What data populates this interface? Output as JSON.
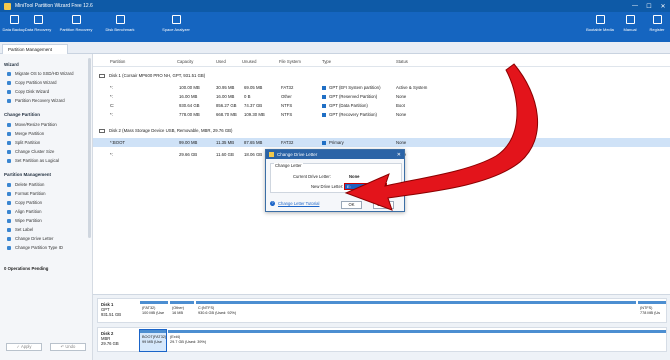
{
  "window": {
    "title": "MiniTool Partition Wizard Free 12.6",
    "controls": [
      "—",
      "☐",
      "✕"
    ]
  },
  "toolbar": {
    "left": [
      "Data Backup",
      "Data Recovery",
      "Partition Recovery",
      "Disk Benchmark",
      "Space Analyzer"
    ],
    "right": [
      "Bootable Media",
      "Manual",
      "Register"
    ]
  },
  "tab": "Partition Management",
  "sidebar": {
    "wizard_head": "Wizard",
    "wizard_items": [
      "Migrate OS to SSD/HD Wizard",
      "Copy Partition Wizard",
      "Copy Disk Wizard",
      "Partition Recovery Wizard"
    ],
    "change_head": "Change Partition",
    "change_items": [
      "Move/Resize Partition",
      "Merge Partition",
      "Split Partition",
      "Change Cluster Size",
      "Set Partition as Logical"
    ],
    "mgmt_head": "Partition Management",
    "mgmt_items": [
      "Delete Partition",
      "Format Partition",
      "Copy Partition",
      "Align Partition",
      "Wipe Partition",
      "Set Label",
      "Change Drive Letter",
      "Change Partition Type ID"
    ],
    "pending": "0 Operations Pending",
    "apply": "✓ Apply",
    "undo": "↶ Undo"
  },
  "table": {
    "headers": [
      "Partition",
      "Capacity",
      "Used",
      "Unused",
      "File System",
      "Type",
      "Status"
    ],
    "disk1": "Disk 1 (Corsair MP600 PRO NH, GPT, 931.51 GB)",
    "disk1_rows": [
      [
        "*:",
        "100.00 MB",
        "30.95 MB",
        "69.05 MB",
        "FAT32",
        "GPT (EFI System partition)",
        "Active & System"
      ],
      [
        "*:",
        "16.00 MB",
        "16.00 MB",
        "0 B",
        "Other",
        "GPT (Reserved Partition)",
        "None"
      ],
      [
        "C:",
        "930.64 GB",
        "856.27 GB",
        "74.37 GB",
        "NTFS",
        "GPT (Data Partition)",
        "Boot"
      ],
      [
        "*:",
        "778.00 MB",
        "668.70 MB",
        "109.30 MB",
        "NTFS",
        "GPT (Recovery Partition)",
        "None"
      ]
    ],
    "disk2": "Disk 2 (Mass Storage Device USB, Removable, MBR, 29.76 GB)",
    "disk2_rows": [
      [
        "*:BOOT",
        "99.00 MB",
        "11.35 MB",
        "87.65 MB",
        "FAT32",
        "Primary",
        "None"
      ],
      [
        "*:",
        "29.66 GB",
        "11.60 GB",
        "18.06 GB",
        "Ext4",
        "Primary",
        "None"
      ]
    ]
  },
  "dialog": {
    "title": "Change Drive Letter",
    "group": "Change Letter",
    "current_label": "Current Drive Letter:",
    "current_value": "None",
    "new_label": "New Drive Letter:",
    "new_value": "E:",
    "help": "Change Letter Tutorial",
    "ok": "OK",
    "cancel": "Cancel"
  },
  "diskmap": {
    "disk1": {
      "name": "Disk 1",
      "style": "GPT",
      "size": "931.51 GB",
      "segments": [
        [
          "(FAT32)",
          "100 MB (Use"
        ],
        [
          "(Other)",
          "16 MB"
        ],
        [
          "C:(NTFS)",
          "930.6 GB (Used: 92%)"
        ],
        [
          "(NTFS)",
          "778 MB (Us"
        ]
      ]
    },
    "disk2": {
      "name": "Disk 2",
      "style": "MBR",
      "size": "29.76 GB",
      "segments": [
        [
          "BOOT(FAT32)",
          "99 MB (Use"
        ],
        [
          "(Ext4)",
          "29.7 GB (Used: 39%)"
        ]
      ]
    }
  },
  "colors": {
    "accent": "#1565c0",
    "arrow": "#e3141b"
  }
}
